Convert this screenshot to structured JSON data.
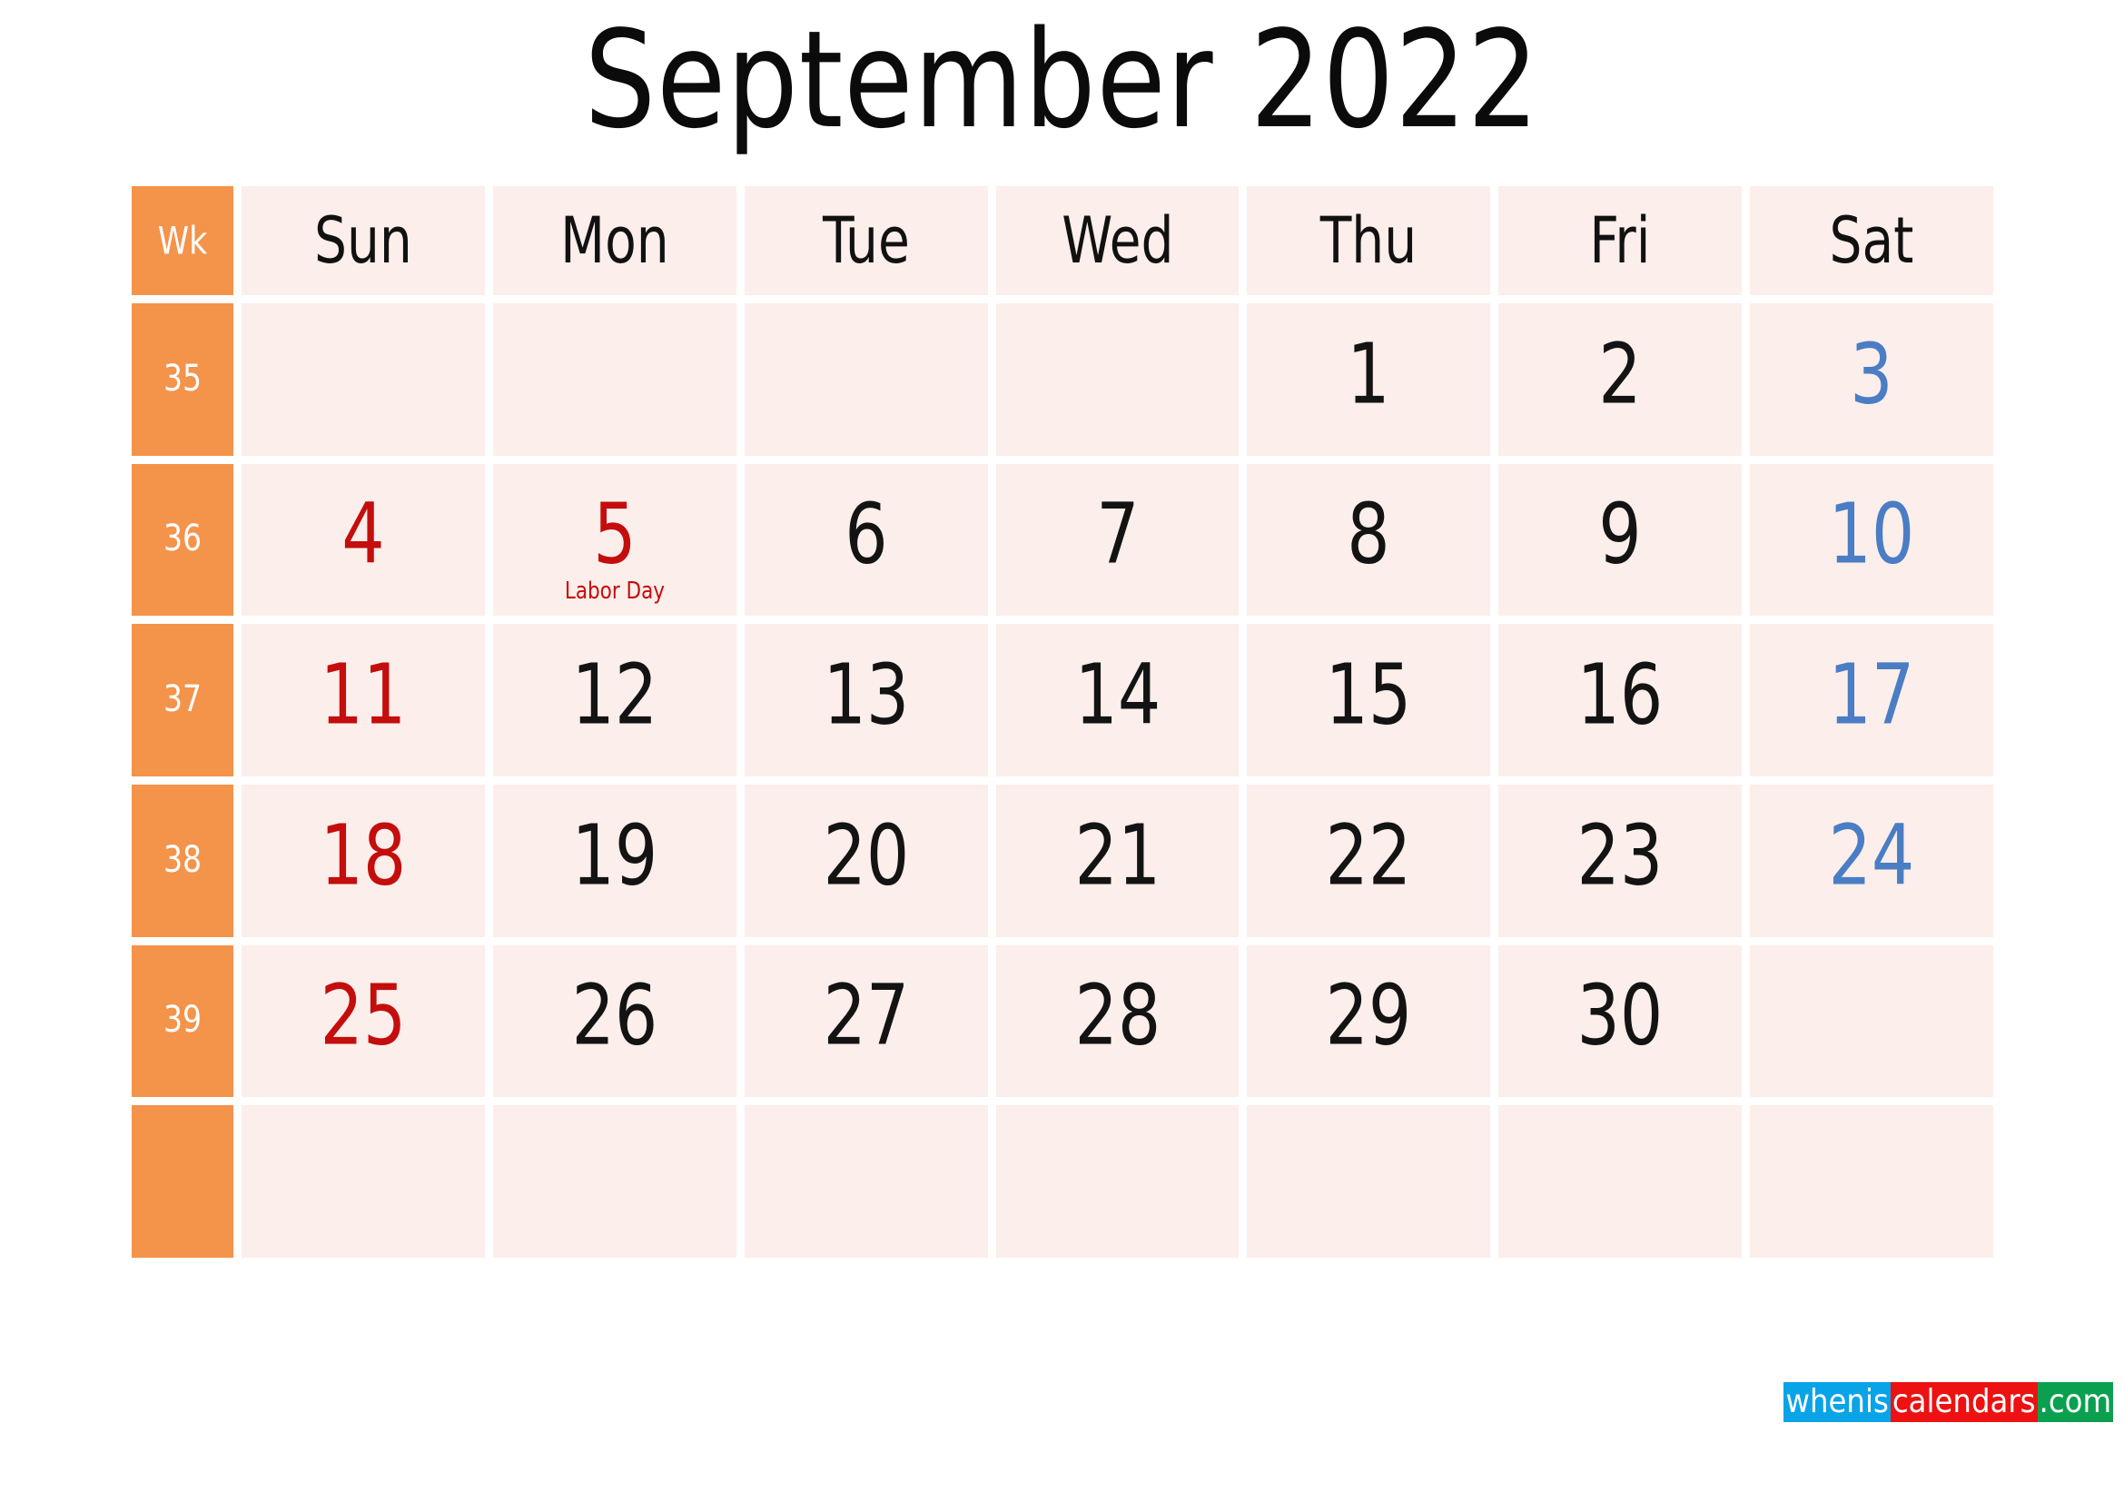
{
  "page": {
    "title": "September 2022",
    "month": "September",
    "year": "2022"
  },
  "colors": {
    "week_column_bg": "#f4934a",
    "cell_bg": "#fceeea",
    "page_bg": "#ffffff",
    "sunday_text": "#c40d0d",
    "saturday_text": "#4a7dc4",
    "weekday_text": "#131313",
    "week_number_text": "#ffffff",
    "holiday_text": "#c40d0d",
    "logo_blue": "#09a3e8",
    "logo_red": "#ee1111",
    "logo_green": "#0aa050"
  },
  "header": {
    "week_label": "Wk",
    "days": [
      "Sun",
      "Mon",
      "Tue",
      "Wed",
      "Thu",
      "Fri",
      "Sat"
    ]
  },
  "weeks": [
    {
      "week_number": "35",
      "days": [
        {
          "day": "",
          "kind": "sun",
          "note": ""
        },
        {
          "day": "",
          "kind": "weekday",
          "note": ""
        },
        {
          "day": "",
          "kind": "weekday",
          "note": ""
        },
        {
          "day": "",
          "kind": "weekday",
          "note": ""
        },
        {
          "day": "1",
          "kind": "weekday",
          "note": ""
        },
        {
          "day": "2",
          "kind": "weekday",
          "note": ""
        },
        {
          "day": "3",
          "kind": "sat",
          "note": ""
        }
      ]
    },
    {
      "week_number": "36",
      "days": [
        {
          "day": "4",
          "kind": "sun",
          "note": ""
        },
        {
          "day": "5",
          "kind": "sun",
          "note": "Labor Day"
        },
        {
          "day": "6",
          "kind": "weekday",
          "note": ""
        },
        {
          "day": "7",
          "kind": "weekday",
          "note": ""
        },
        {
          "day": "8",
          "kind": "weekday",
          "note": ""
        },
        {
          "day": "9",
          "kind": "weekday",
          "note": ""
        },
        {
          "day": "10",
          "kind": "sat",
          "note": ""
        }
      ]
    },
    {
      "week_number": "37",
      "days": [
        {
          "day": "11",
          "kind": "sun",
          "note": ""
        },
        {
          "day": "12",
          "kind": "weekday",
          "note": ""
        },
        {
          "day": "13",
          "kind": "weekday",
          "note": ""
        },
        {
          "day": "14",
          "kind": "weekday",
          "note": ""
        },
        {
          "day": "15",
          "kind": "weekday",
          "note": ""
        },
        {
          "day": "16",
          "kind": "weekday",
          "note": ""
        },
        {
          "day": "17",
          "kind": "sat",
          "note": ""
        }
      ]
    },
    {
      "week_number": "38",
      "days": [
        {
          "day": "18",
          "kind": "sun",
          "note": ""
        },
        {
          "day": "19",
          "kind": "weekday",
          "note": ""
        },
        {
          "day": "20",
          "kind": "weekday",
          "note": ""
        },
        {
          "day": "21",
          "kind": "weekday",
          "note": ""
        },
        {
          "day": "22",
          "kind": "weekday",
          "note": ""
        },
        {
          "day": "23",
          "kind": "weekday",
          "note": ""
        },
        {
          "day": "24",
          "kind": "sat",
          "note": ""
        }
      ]
    },
    {
      "week_number": "39",
      "days": [
        {
          "day": "25",
          "kind": "sun",
          "note": ""
        },
        {
          "day": "26",
          "kind": "weekday",
          "note": ""
        },
        {
          "day": "27",
          "kind": "weekday",
          "note": ""
        },
        {
          "day": "28",
          "kind": "weekday",
          "note": ""
        },
        {
          "day": "29",
          "kind": "weekday",
          "note": ""
        },
        {
          "day": "30",
          "kind": "weekday",
          "note": ""
        },
        {
          "day": "",
          "kind": "sat",
          "note": ""
        }
      ]
    },
    {
      "week_number": "",
      "days": [
        {
          "day": "",
          "kind": "sun",
          "note": ""
        },
        {
          "day": "",
          "kind": "weekday",
          "note": ""
        },
        {
          "day": "",
          "kind": "weekday",
          "note": ""
        },
        {
          "day": "",
          "kind": "weekday",
          "note": ""
        },
        {
          "day": "",
          "kind": "weekday",
          "note": ""
        },
        {
          "day": "",
          "kind": "weekday",
          "note": ""
        },
        {
          "day": "",
          "kind": "sat",
          "note": ""
        }
      ]
    }
  ],
  "logo": {
    "part1": "whenis",
    "part2": "calendars",
    "part3": ".com"
  }
}
